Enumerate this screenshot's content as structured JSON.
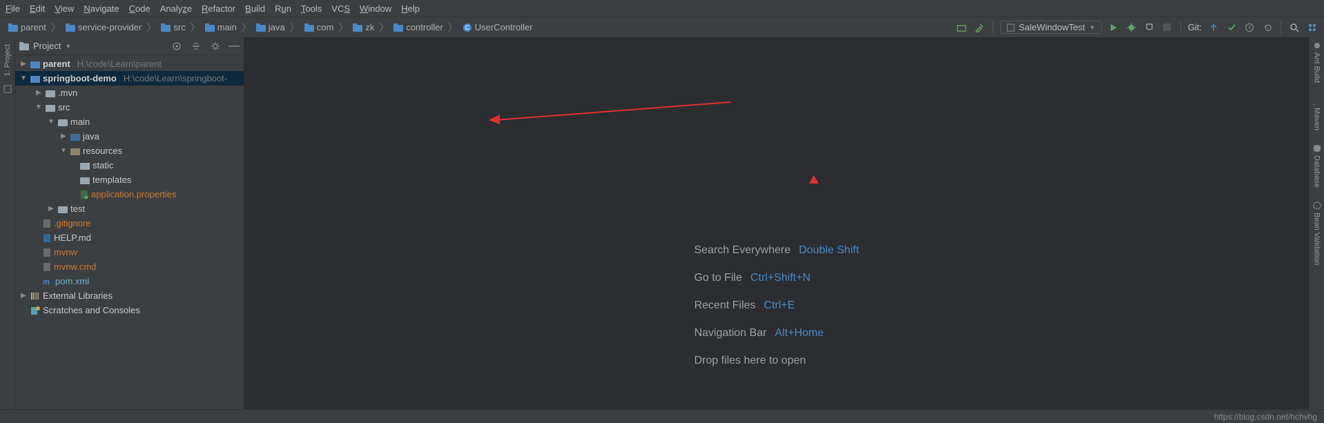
{
  "menu": [
    "File",
    "Edit",
    "View",
    "Navigate",
    "Code",
    "Analyze",
    "Refactor",
    "Build",
    "Run",
    "Tools",
    "VCS",
    "Window",
    "Help"
  ],
  "breadcrumbs": [
    {
      "icon": "folder",
      "label": "parent"
    },
    {
      "icon": "folder",
      "label": "service-provider"
    },
    {
      "icon": "folder",
      "label": "src"
    },
    {
      "icon": "folder",
      "label": "main"
    },
    {
      "icon": "folder",
      "label": "java"
    },
    {
      "icon": "folder",
      "label": "com"
    },
    {
      "icon": "folder",
      "label": "zk"
    },
    {
      "icon": "folder",
      "label": "controller"
    },
    {
      "icon": "class",
      "label": "UserController"
    }
  ],
  "runConfig": "SaleWindowTest",
  "gitLabel": "Git:",
  "panelTitle": "Project",
  "leftGutter": "1: Project",
  "rightGutter": [
    "Ant Build",
    "Maven",
    "Database",
    "Bean Validation"
  ],
  "tree": {
    "parent": {
      "name": "parent",
      "path": "H:\\code\\Learn\\parent"
    },
    "springboot": {
      "name": "springboot-demo",
      "path": "H:\\code\\Learn\\springboot-"
    },
    "mvn": ".mvn",
    "src": "src",
    "main": "main",
    "java": "java",
    "resources": "resources",
    "static": "static",
    "templates": "templates",
    "appprops": "application.properties",
    "test": "test",
    "gitignore": ".gitignore",
    "helpmd": "HELP.md",
    "mvnw": "mvnw",
    "mvnwcmd": "mvnw.cmd",
    "pom": "pom.xml",
    "extlib": "External Libraries",
    "scratches": "Scratches and Consoles"
  },
  "hints": [
    {
      "label": "Search Everywhere",
      "key": "Double Shift"
    },
    {
      "label": "Go to File",
      "key": "Ctrl+Shift+N"
    },
    {
      "label": "Recent Files",
      "key": "Ctrl+E"
    },
    {
      "label": "Navigation Bar",
      "key": "Alt+Home"
    },
    {
      "label": "Drop files here to open",
      "key": ""
    }
  ],
  "watermark": "https://blog.csdn.net/hchvhg"
}
